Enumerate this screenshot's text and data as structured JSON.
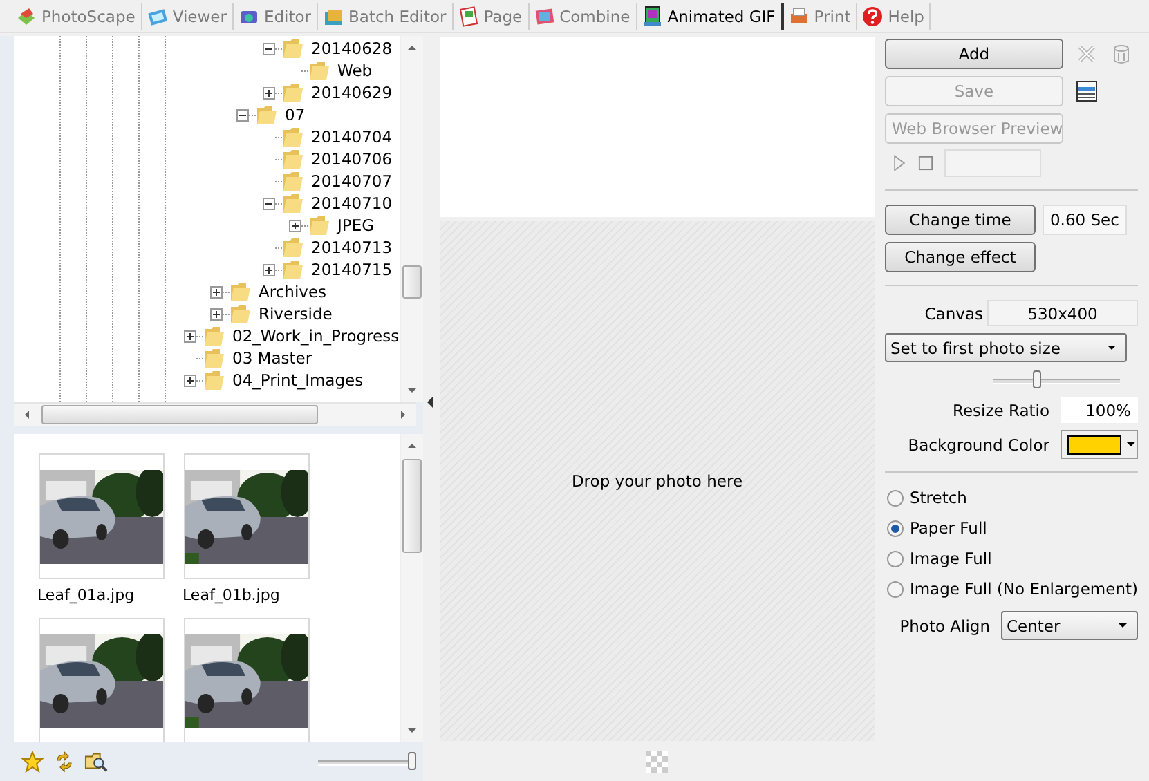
{
  "tabs": [
    {
      "label": "PhotoScape",
      "selected": false
    },
    {
      "label": "Viewer",
      "selected": false
    },
    {
      "label": "Editor",
      "selected": false
    },
    {
      "label": "Batch Editor",
      "selected": false
    },
    {
      "label": "Page",
      "selected": false
    },
    {
      "label": "Combine",
      "selected": false
    },
    {
      "label": "Animated GIF",
      "selected": true
    },
    {
      "label": "Print",
      "selected": false
    },
    {
      "label": "Help",
      "selected": false
    }
  ],
  "folder_tree": {
    "items": [
      {
        "children": [
          {
            "children": [
              {
                "children": [
                  {
                    "label": "20140628",
                    "expanded": true,
                    "children": [
                      {
                        "label": "Web"
                      }
                    ]
                  },
                  {
                    "label": "20140629",
                    "expanded": false
                  }
                ]
              },
              {
                "label": "07",
                "expanded": true,
                "children": [
                  {
                    "label": "20140704"
                  },
                  {
                    "label": "20140706"
                  },
                  {
                    "label": "20140707"
                  },
                  {
                    "label": "20140710",
                    "expanded": true,
                    "children": [
                      {
                        "label": "JPEG",
                        "expanded": false
                      }
                    ]
                  },
                  {
                    "label": "20140713"
                  },
                  {
                    "label": "20140715",
                    "expanded": false
                  }
                ]
              }
            ]
          },
          {
            "label": "Archives",
            "expanded": false
          },
          {
            "label": "Riverside",
            "expanded": false
          }
        ]
      },
      {
        "label": "02_Work_in_Progress",
        "expanded": false
      },
      {
        "label": "03 Master"
      },
      {
        "label": "04_Print_Images",
        "expanded": false
      }
    ]
  },
  "thumbnails": [
    {
      "kind": "picture",
      "filename": "Leaf_01a.jpg"
    },
    {
      "kind": "picture",
      "filename": "Leaf_01b.jpg"
    },
    {
      "kind": "picture"
    },
    {
      "kind": "picture"
    }
  ],
  "thumbnail_size_slider": {
    "level": 1
  },
  "preview": {
    "drop_hint": "Drop your photo here"
  },
  "controls": {
    "add_button": {
      "label": "Add",
      "disabled": false
    },
    "save_button": {
      "label": "Save",
      "disabled": true
    },
    "preview_button": {
      "label": "Web Browser Preview",
      "disabled": true
    },
    "change_time_button": "Change time",
    "frame_time": "0.60 Sec",
    "change_effect_button": "Change effect",
    "canvas_label": "Canvas",
    "canvas_size": "530x400",
    "size_mode": "Set to first photo size",
    "size_slider": {
      "level": 0.35
    },
    "resize_ratio_label": "Resize Ratio",
    "resize_ratio": "100%",
    "background_color_label": "Background Color",
    "background_color": {
      "color": "#ffd200"
    },
    "fit_options": [
      {
        "label": "Stretch",
        "selected": false
      },
      {
        "label": "Paper Full",
        "selected": true
      },
      {
        "label": "Image Full",
        "selected": false
      },
      {
        "label": "Image Full (No Enlargement)",
        "selected": false
      }
    ],
    "photo_align_label": "Photo Align",
    "photo_align": "Center"
  }
}
